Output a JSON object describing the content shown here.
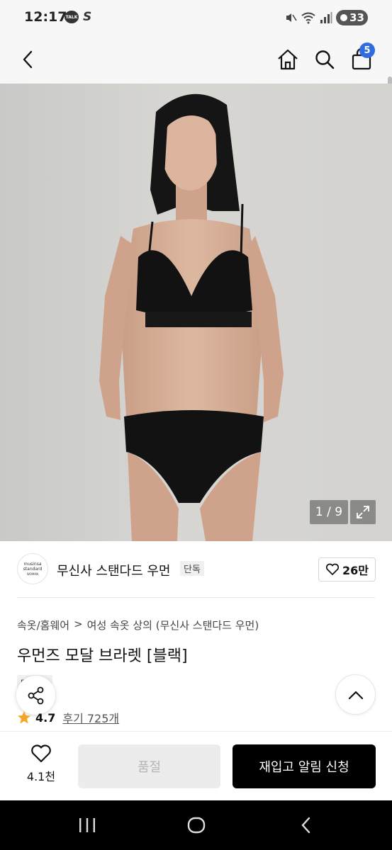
{
  "status_bar": {
    "time": "12:17",
    "talk_icon_label": "TALK",
    "battery_level": "33"
  },
  "header": {
    "cart_count": "5"
  },
  "product_image": {
    "counter": "1 / 9"
  },
  "brand": {
    "logo_text_line1": "musinsa",
    "logo_text_line2": "standard",
    "logo_text_line3": "WOMAN",
    "name": "무신사 스탠다드 우먼",
    "exclusive_tag": "단독",
    "like_count": "26만"
  },
  "product": {
    "breadcrumb": [
      "속옷/홈웨어",
      "여성 속옷 상의 (무신사 스탠다드 우먼)"
    ],
    "breadcrumb_separator": ">",
    "title": "우먼즈 모달 브라렛 [블랙]",
    "badge_text": "단독",
    "badge_prefix": "무",
    "rating": "4.7",
    "review_link": "후기 725개"
  },
  "bottom_bar": {
    "wish_count": "4.1천",
    "soldout_label": "품절",
    "restock_label": "재입고 알림 신청"
  },
  "icons": {
    "back": "back-arrow-icon",
    "home": "home-icon",
    "search": "search-icon",
    "cart": "shopping-bag-icon",
    "expand": "expand-icon",
    "heart": "heart-icon",
    "share": "share-icon",
    "scroll_top": "chevron-up-icon",
    "star": "star-icon"
  },
  "colors": {
    "accent_badge": "#2f6de1",
    "primary_button": "#000000",
    "star": "#f4a62a"
  }
}
